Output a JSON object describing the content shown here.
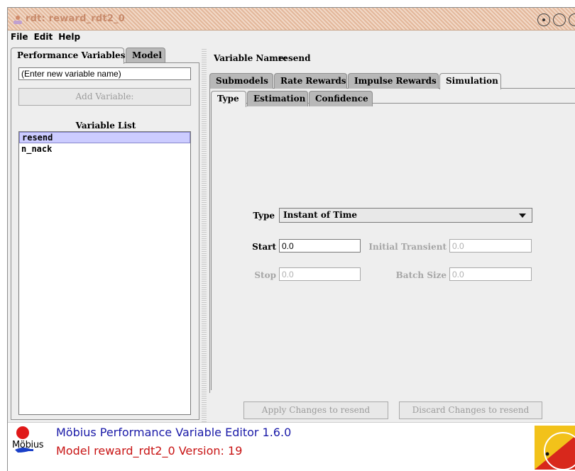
{
  "window": {
    "title": "rdt: reward_rdt2_0"
  },
  "menu": [
    "File",
    "Edit",
    "Help"
  ],
  "left": {
    "tabs": [
      "Performance Variables",
      "Model"
    ],
    "name_input_value": "(Enter new variable name)",
    "add_button_label": "Add Variable:",
    "list_title": "Variable List",
    "variables": [
      "resend",
      "n_nack"
    ],
    "selected_variable": "resend"
  },
  "right": {
    "variable_name_label": "Variable Name:",
    "variable_name_value": "resend",
    "outer_tabs": [
      "Submodels",
      "Rate Rewards",
      "Impulse Rewards",
      "Simulation"
    ],
    "outer_active": "Simulation",
    "inner_tabs": [
      "Type",
      "Estimation",
      "Confidence"
    ],
    "inner_active": "Type",
    "form": {
      "type_label": "Type",
      "type_value": "Instant of Time",
      "start_label": "Start",
      "start_value": "0.0",
      "initial_transient_label": "Initial Transient",
      "initial_transient_value": "0.0",
      "stop_label": "Stop",
      "stop_value": "0.0",
      "batch_size_label": "Batch Size",
      "batch_size_value": "0.0"
    },
    "apply_button_label": "Apply Changes to resend",
    "discard_button_label": "Discard Changes to resend"
  },
  "footer": {
    "logo_text": "Möbius",
    "line1": "Möbius Performance Variable Editor 1.6.0",
    "line2_prefix": "Model reward_rdt2_0  Version:",
    "line2_version": "19"
  },
  "colors": {
    "title_text": "#c88b6c",
    "footer_blue": "#1a1aa8",
    "footer_red": "#c81414",
    "selection": "#ccccff",
    "inactive_tab": "#b8b8b8"
  }
}
